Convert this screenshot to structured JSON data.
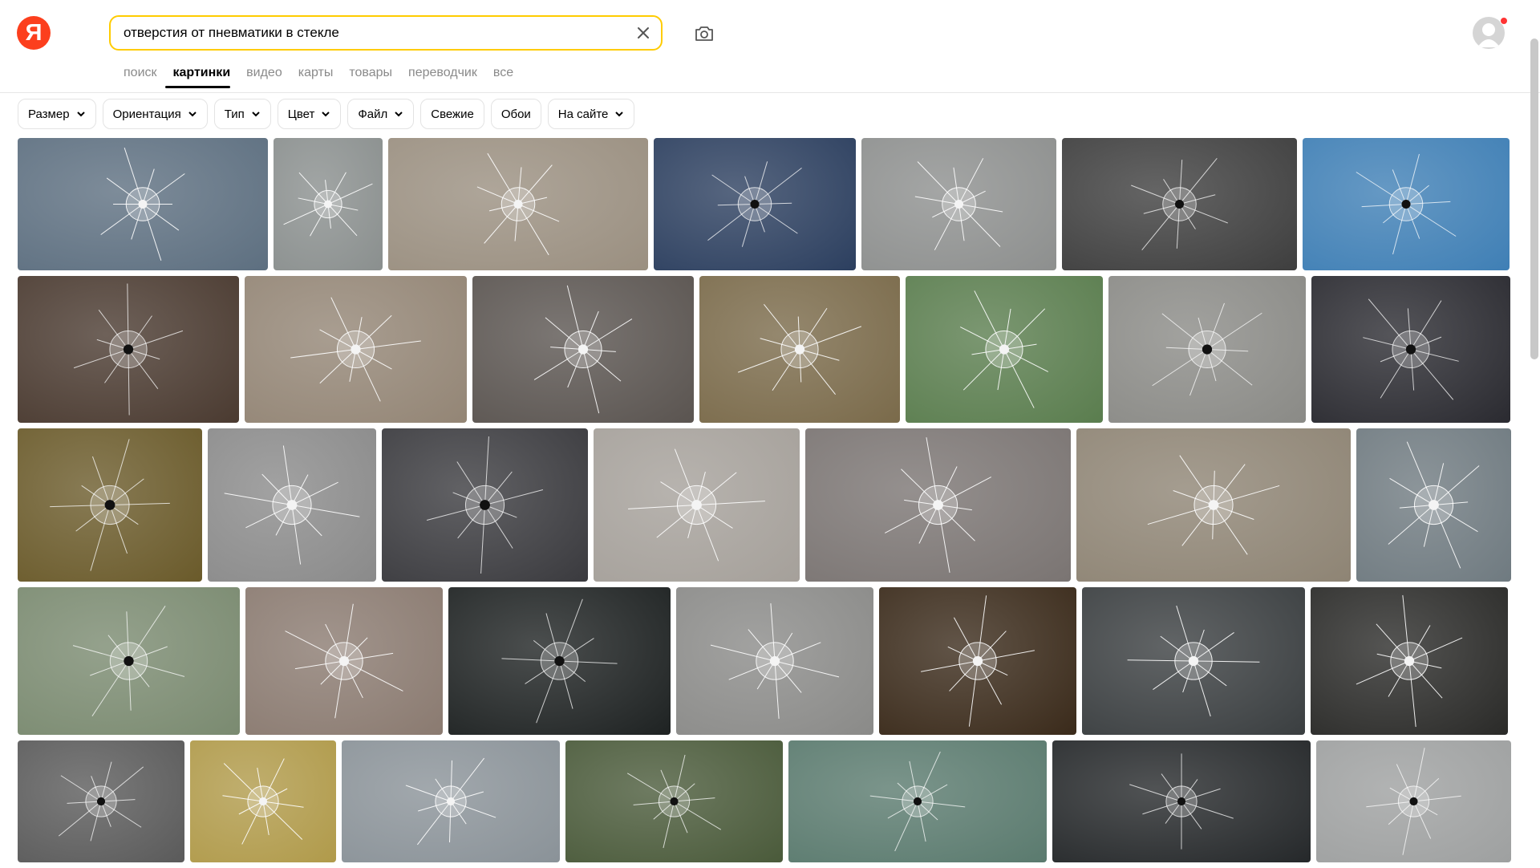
{
  "logo": {
    "letter": "Я"
  },
  "search": {
    "query": "отверстия от пневматики в стекле",
    "placeholder": ""
  },
  "tabs": [
    {
      "label": "поиск",
      "active": false
    },
    {
      "label": "картинки",
      "active": true
    },
    {
      "label": "видео",
      "active": false
    },
    {
      "label": "карты",
      "active": false
    },
    {
      "label": "товары",
      "active": false
    },
    {
      "label": "переводчик",
      "active": false
    },
    {
      "label": "все",
      "active": false
    }
  ],
  "filters": [
    {
      "label": "Размер",
      "dropdown": true
    },
    {
      "label": "Ориентация",
      "dropdown": true
    },
    {
      "label": "Тип",
      "dropdown": true
    },
    {
      "label": "Цвет",
      "dropdown": true
    },
    {
      "label": "Файл",
      "dropdown": true
    },
    {
      "label": "Свежие",
      "dropdown": false
    },
    {
      "label": "Обои",
      "dropdown": false
    },
    {
      "label": "На сайте",
      "dropdown": true
    }
  ],
  "colors": {
    "accent": "#ffcc00",
    "brand": "#fc3f1d",
    "notification": "#ff3333"
  },
  "icons": {
    "clear": "close-icon",
    "camera": "camera-icon",
    "avatar": "user-icon",
    "chevron": "chevron-down-icon"
  },
  "image_grid_rows": [
    {
      "images": [
        {
          "bg": "#5d6f80",
          "hole": "light"
        },
        {
          "bg": "#8a8f8e",
          "hole": "light"
        },
        {
          "bg": "#9a8f80",
          "hole": "light"
        },
        {
          "bg": "#2c3f5f",
          "hole": "dark"
        },
        {
          "bg": "#8d8f8e",
          "hole": "light"
        },
        {
          "bg": "#3e3e3e",
          "hole": "dark"
        },
        {
          "bg": "#3f7fb5",
          "hole": "dark"
        }
      ]
    },
    {
      "images": [
        {
          "bg": "#4a3a30",
          "hole": "dark"
        },
        {
          "bg": "#938575",
          "hole": "light"
        },
        {
          "bg": "#5a5450",
          "hole": "light"
        },
        {
          "bg": "#7a6a4a",
          "hole": "light"
        },
        {
          "bg": "#5a7d4e",
          "hole": "light"
        },
        {
          "bg": "#8a8a86",
          "hole": "dark"
        },
        {
          "bg": "#2a2a30",
          "hole": "dark"
        }
      ]
    },
    {
      "images": [
        {
          "bg": "#6a5a2a",
          "hole": "dark"
        },
        {
          "bg": "#8a8a8a",
          "hole": "light"
        },
        {
          "bg": "#3a3a3e",
          "hole": "dark"
        },
        {
          "bg": "#a5a09a",
          "hole": "light"
        },
        {
          "bg": "#7a7472",
          "hole": "light"
        },
        {
          "bg": "#8e8474",
          "hole": "light"
        },
        {
          "bg": "#6f7a80",
          "hole": "light"
        }
      ]
    },
    {
      "images": [
        {
          "bg": "#7a8a70",
          "hole": "dark"
        },
        {
          "bg": "#8a7a70",
          "hole": "light"
        },
        {
          "bg": "#1e2222",
          "hole": "dark"
        },
        {
          "bg": "#8a8a88",
          "hole": "light"
        },
        {
          "bg": "#3a2a1a",
          "hole": "light"
        },
        {
          "bg": "#3a3e40",
          "hole": "light"
        },
        {
          "bg": "#2a2a28",
          "hole": "light"
        }
      ]
    },
    {
      "images": [
        {
          "bg": "#5a5a5a",
          "hole": "dark"
        },
        {
          "bg": "#b09a4a",
          "hole": "light"
        },
        {
          "bg": "#8a9298",
          "hole": "light"
        },
        {
          "bg": "#4a5a3a",
          "hole": "dark"
        },
        {
          "bg": "#5a7a6e",
          "hole": "dark"
        },
        {
          "bg": "#25282a",
          "hole": "dark"
        },
        {
          "bg": "#9ea0a0",
          "hole": "dark"
        }
      ]
    }
  ]
}
